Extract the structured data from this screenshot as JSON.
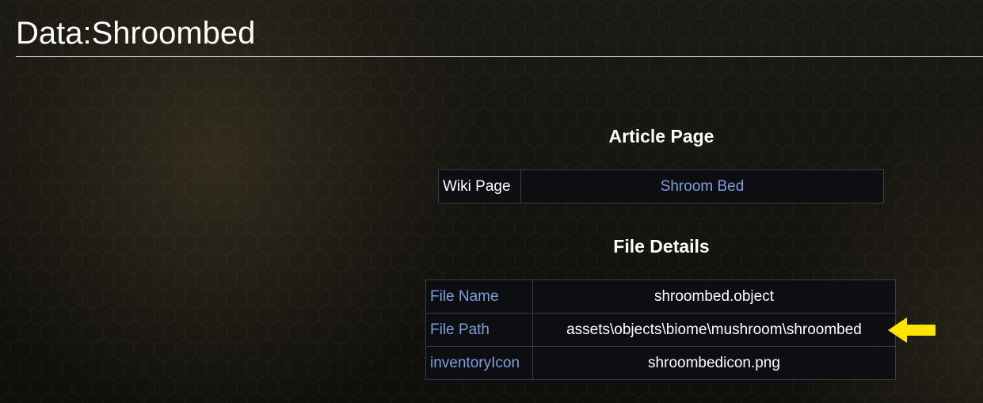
{
  "page": {
    "title": "Data:Shroombed"
  },
  "article_section": {
    "heading": "Article Page",
    "rows": [
      {
        "label": "Wiki Page",
        "value": "Shroom Bed"
      }
    ]
  },
  "file_section": {
    "heading": "File Details",
    "rows": [
      {
        "label": "File Name",
        "value": "shroombed.object"
      },
      {
        "label": "File Path",
        "value": "assets\\objects\\biome\\mushroom\\shroombed"
      },
      {
        "label": "inventoryIcon",
        "value": "shroombedicon.png"
      }
    ]
  },
  "colors": {
    "link": "#7e9fdc",
    "arrow": "#ffe400",
    "background": "#14120e"
  },
  "icons": {
    "pointer": "arrow-left-icon"
  }
}
